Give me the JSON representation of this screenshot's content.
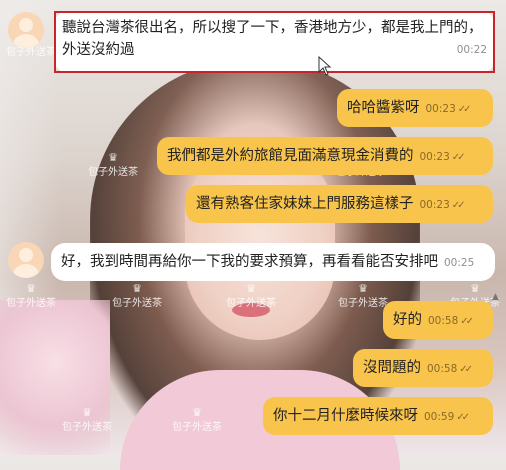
{
  "watermark": "包子外送茶",
  "messages": [
    {
      "side": "in",
      "line1": "聽說台灣茶很出名，所以搜了一下，香港地方少，都是我上門的，",
      "line2": "外送沒約過",
      "time": "00:22"
    },
    {
      "side": "out",
      "text": "哈哈醬紫呀",
      "time": "00:23"
    },
    {
      "side": "out",
      "text": "我們都是外約旅館見面滿意現金消費的",
      "time": "00:23"
    },
    {
      "side": "out",
      "text": "還有熟客住家妹妹上門服務這樣子",
      "time": "00:23"
    },
    {
      "side": "in",
      "text": "好，我到時間再給你一下我的要求預算，再看看能否安排吧",
      "time": "00:25"
    },
    {
      "side": "out",
      "text": "好的",
      "time": "00:58"
    },
    {
      "side": "out",
      "text": "沒問題的",
      "time": "00:58"
    },
    {
      "side": "out",
      "text": "你十二月什麼時候來呀",
      "time": "00:59"
    }
  ],
  "colors": {
    "out_bubble": "#f8c44c",
    "in_bubble": "#ffffff",
    "highlight": "#c8242c"
  },
  "icons": {
    "read_receipt": "double-check-icon",
    "cursor": "mouse-pointer-icon",
    "avatar": "user-avatar-icon"
  }
}
